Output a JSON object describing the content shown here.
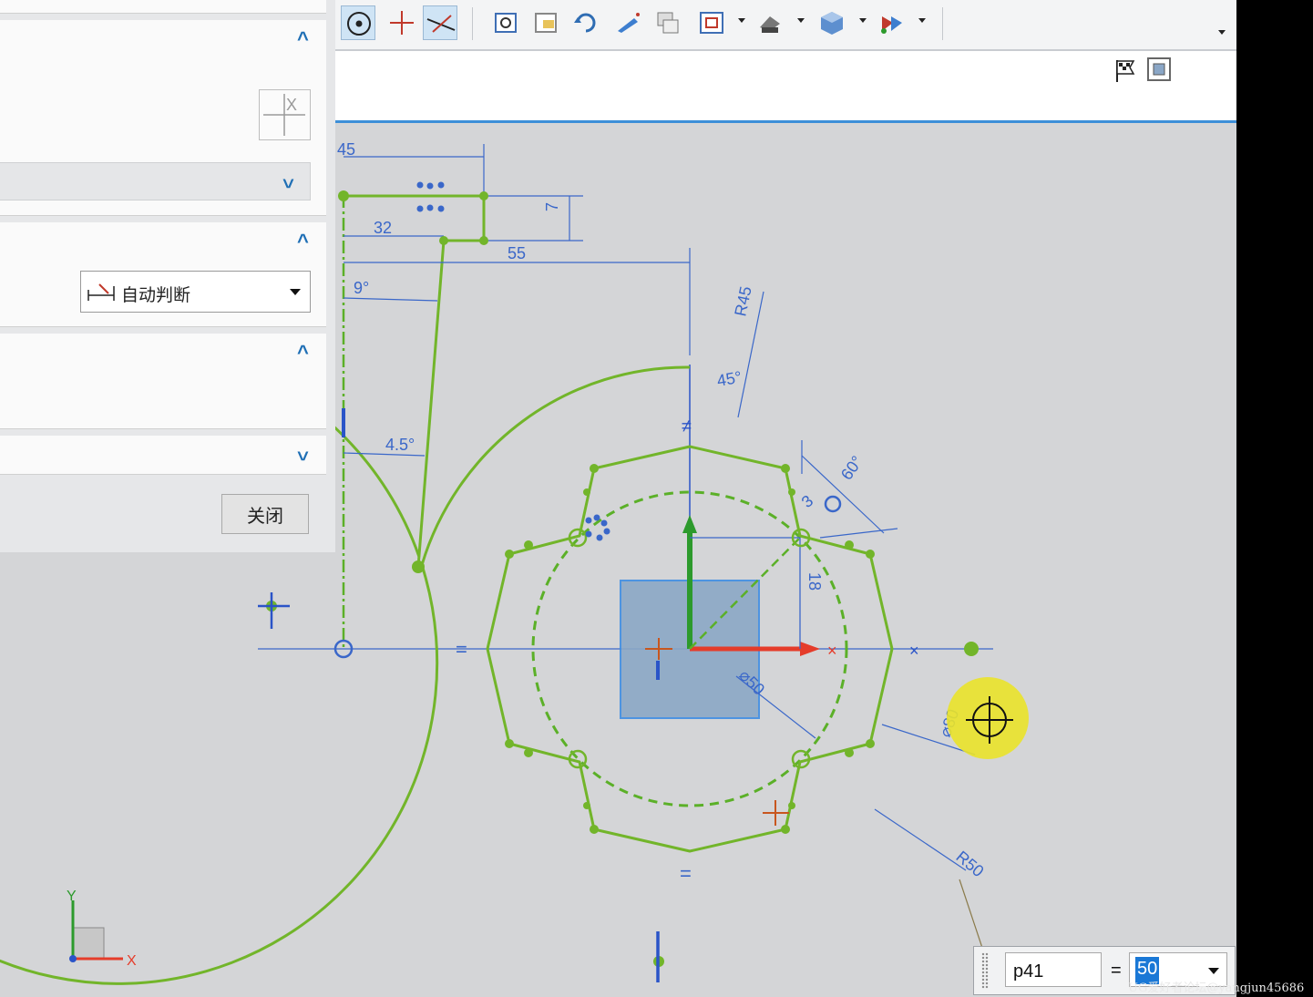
{
  "toolbar": {
    "icons": [
      "point-on-curve-icon",
      "point-icon",
      "trim-icon",
      "fit-view-icon",
      "zoom-window-icon",
      "rotate-icon",
      "pan-icon",
      "layer-icon",
      "orient-view-icon",
      "render-style-icon",
      "shaded-view-icon",
      "display-edges-icon"
    ],
    "more_label": "▼"
  },
  "dialog": {
    "type_select_value": "自动判断",
    "close_label": "关闭"
  },
  "sketch": {
    "dims": [
      "45",
      "32",
      "55",
      "7",
      "9°",
      "4.5°",
      "R45",
      "45°",
      "60°",
      "3",
      "18",
      "⌀50",
      "⌀80",
      "R50",
      "="
    ],
    "axis_x": "X",
    "axis_y": "Y"
  },
  "dim_input": {
    "name": "p41",
    "equals": "=",
    "value": "50"
  },
  "watermark": "UG爱好者论坛@yangjun45686"
}
